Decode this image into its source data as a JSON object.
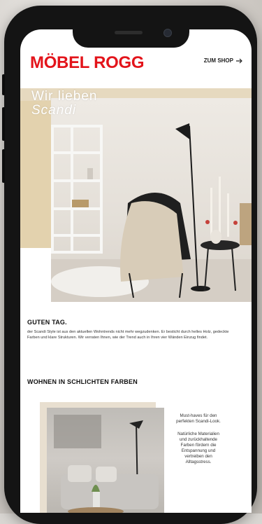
{
  "brand": {
    "name": "MÖBEL ROGG"
  },
  "header": {
    "shop_label": "ZUM SHOP"
  },
  "hero": {
    "line1": "Wir lieben",
    "line2": "Scandi"
  },
  "intro": {
    "title": "GUTEN TAG.",
    "text": "der Scandi Style ist aus den aktuellen Wohntrends nicht mehr wegzudenken. Er besticht durch helles Holz, gedeckte Farben und klare Strukturen. Wir verraten Ihnen, wie der Trend auch in Ihren vier Wänden Einzug findet."
  },
  "section2": {
    "title": "WOHNEN IN SCHLICHTEN FARBEN",
    "side_p1": "Must-haves für den perfekten Scandi-Look.",
    "side_p2": "Natürliche Materialien und zurückhaltende Farben fördern die Entspannung und vertreiben den Alltagsstress."
  },
  "icons": {
    "shop_arrow": "arrow-right-icon"
  },
  "colors": {
    "brand_red": "#e3141b",
    "accent_beige": "#e3d2ae"
  }
}
